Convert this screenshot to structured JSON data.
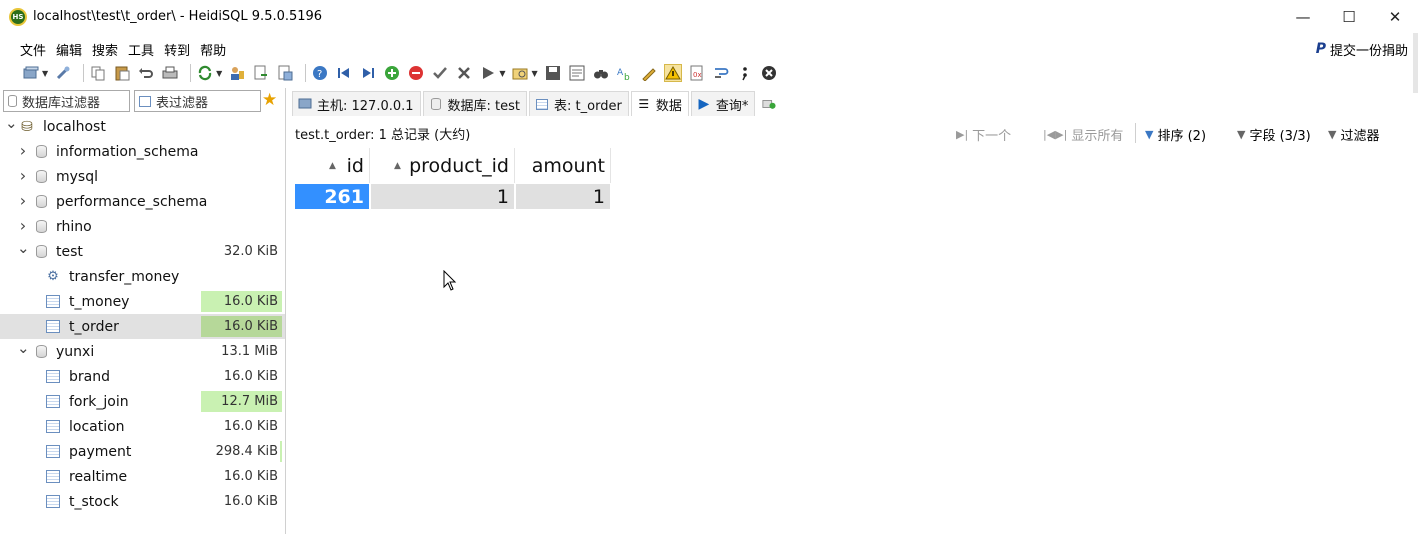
{
  "window": {
    "title": "localhost\\test\\t_order\\ - HeidiSQL 9.5.0.5196",
    "app_icon_text": "HS",
    "minimize": "—",
    "maximize": "☐",
    "close": "✕"
  },
  "menu": {
    "items": [
      "文件",
      "编辑",
      "搜索",
      "工具",
      "转到",
      "帮助"
    ],
    "donate_logo": "P",
    "donate": "提交一份捐助"
  },
  "filters": {
    "db_filter": "数据库过滤器",
    "table_filter": "表过滤器"
  },
  "tree": {
    "items": [
      {
        "label": "localhost",
        "size": "",
        "type": "server",
        "expanded": true
      },
      {
        "label": "information_schema",
        "size": "",
        "type": "db",
        "expanded": false
      },
      {
        "label": "mysql",
        "size": "",
        "type": "db",
        "expanded": false
      },
      {
        "label": "performance_schema",
        "size": "",
        "type": "db",
        "expanded": false
      },
      {
        "label": "rhino",
        "size": "",
        "type": "db",
        "expanded": false
      },
      {
        "label": "test",
        "size": "32.0 KiB",
        "type": "db",
        "expanded": true
      },
      {
        "label": "transfer_money",
        "size": "",
        "type": "procedure"
      },
      {
        "label": "t_money",
        "size": "16.0 KiB",
        "type": "table",
        "bar": 1.0
      },
      {
        "label": "t_order",
        "size": "16.0 KiB",
        "type": "table",
        "bar": 1.0,
        "selected": true
      },
      {
        "label": "yunxi",
        "size": "13.1 MiB",
        "type": "db",
        "expanded": true
      },
      {
        "label": "brand",
        "size": "16.0 KiB",
        "type": "table",
        "bar": 0.0
      },
      {
        "label": "fork_join",
        "size": "12.7 MiB",
        "type": "table",
        "bar": 1.0
      },
      {
        "label": "location",
        "size": "16.0 KiB",
        "type": "table",
        "bar": 0.0
      },
      {
        "label": "payment",
        "size": "298.4 KiB",
        "type": "table",
        "bar": 0.02
      },
      {
        "label": "realtime",
        "size": "16.0 KiB",
        "type": "table",
        "bar": 0.0
      },
      {
        "label": "t_stock",
        "size": "16.0 KiB",
        "type": "table",
        "bar": 0.0
      }
    ]
  },
  "tabs": {
    "host": "主机: 127.0.0.1",
    "database": "数据库: test",
    "table": "表: t_order",
    "data": "数据",
    "query": "查询*"
  },
  "grid": {
    "info": "test.t_order: 1 总记录 (大约)",
    "next": "下一个",
    "show_all": "显示所有",
    "sort": "排序 (2)",
    "columns": "字段 (3/3)",
    "filter": "过滤器",
    "headers": [
      "id",
      "product_id",
      "amount"
    ],
    "rows": [
      [
        "261",
        "1",
        "1"
      ]
    ]
  },
  "colors": {
    "selection_blue": "#3390ff",
    "size_bar_green": "#c9f1b2"
  }
}
